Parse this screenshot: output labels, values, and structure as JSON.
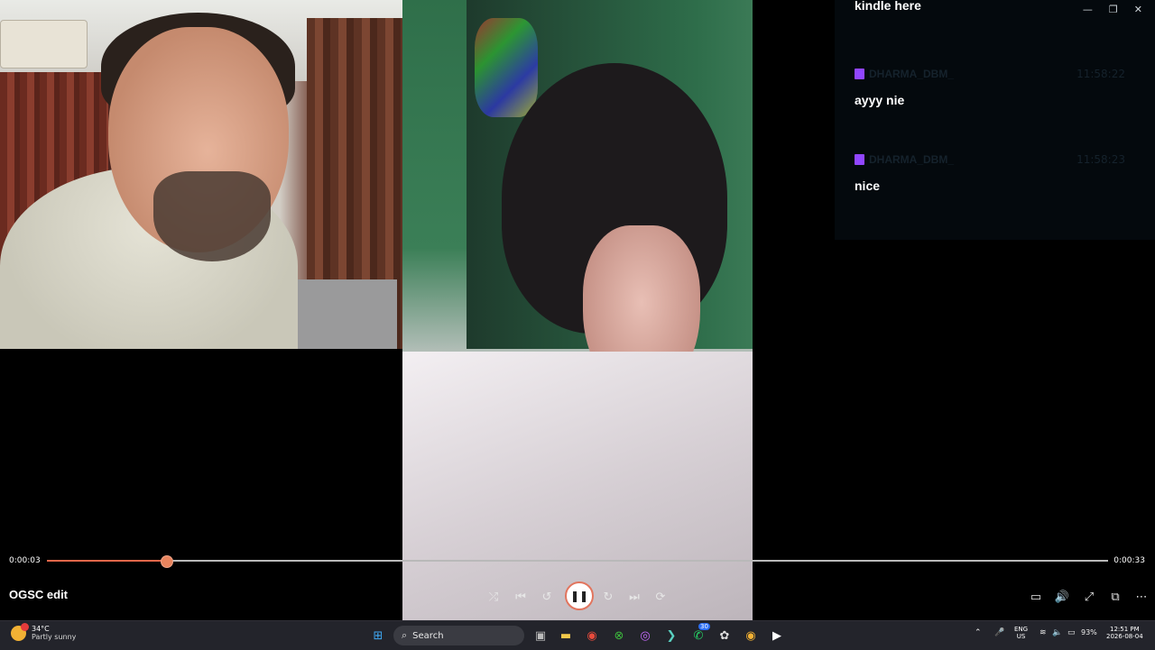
{
  "player": {
    "title": "OGSC edit",
    "elapsed": "0:00:03",
    "duration": "0:00:33",
    "progress_fraction": 0.112,
    "colors": {
      "accent": "#e8674a"
    }
  },
  "chat": {
    "messages": [
      {
        "user": "",
        "time": "",
        "text": "kindle here"
      },
      {
        "user": "DHARMA_DBM_",
        "time": "11:58:22",
        "text": "ayyy nie"
      },
      {
        "user": "DHARMA_DBM_",
        "time": "11:58:23",
        "text": "nice"
      }
    ]
  },
  "taskbar": {
    "weather_temp": "34°C",
    "weather_desc": "Partly sunny",
    "search_label": "Search",
    "lang_top": "ENG",
    "lang_bottom": "US",
    "battery": "93%",
    "time": "12:51 PM",
    "date": "2026-08-04",
    "badge_count": "30"
  },
  "icons": [
    "shuffle-icon",
    "previous-icon",
    "rewind-10-icon",
    "pause-icon",
    "forward-30-icon",
    "next-icon",
    "repeat-icon",
    "miniplayer-icon",
    "volume-icon",
    "fullscreen-icon",
    "cast-icon",
    "more-icon"
  ]
}
